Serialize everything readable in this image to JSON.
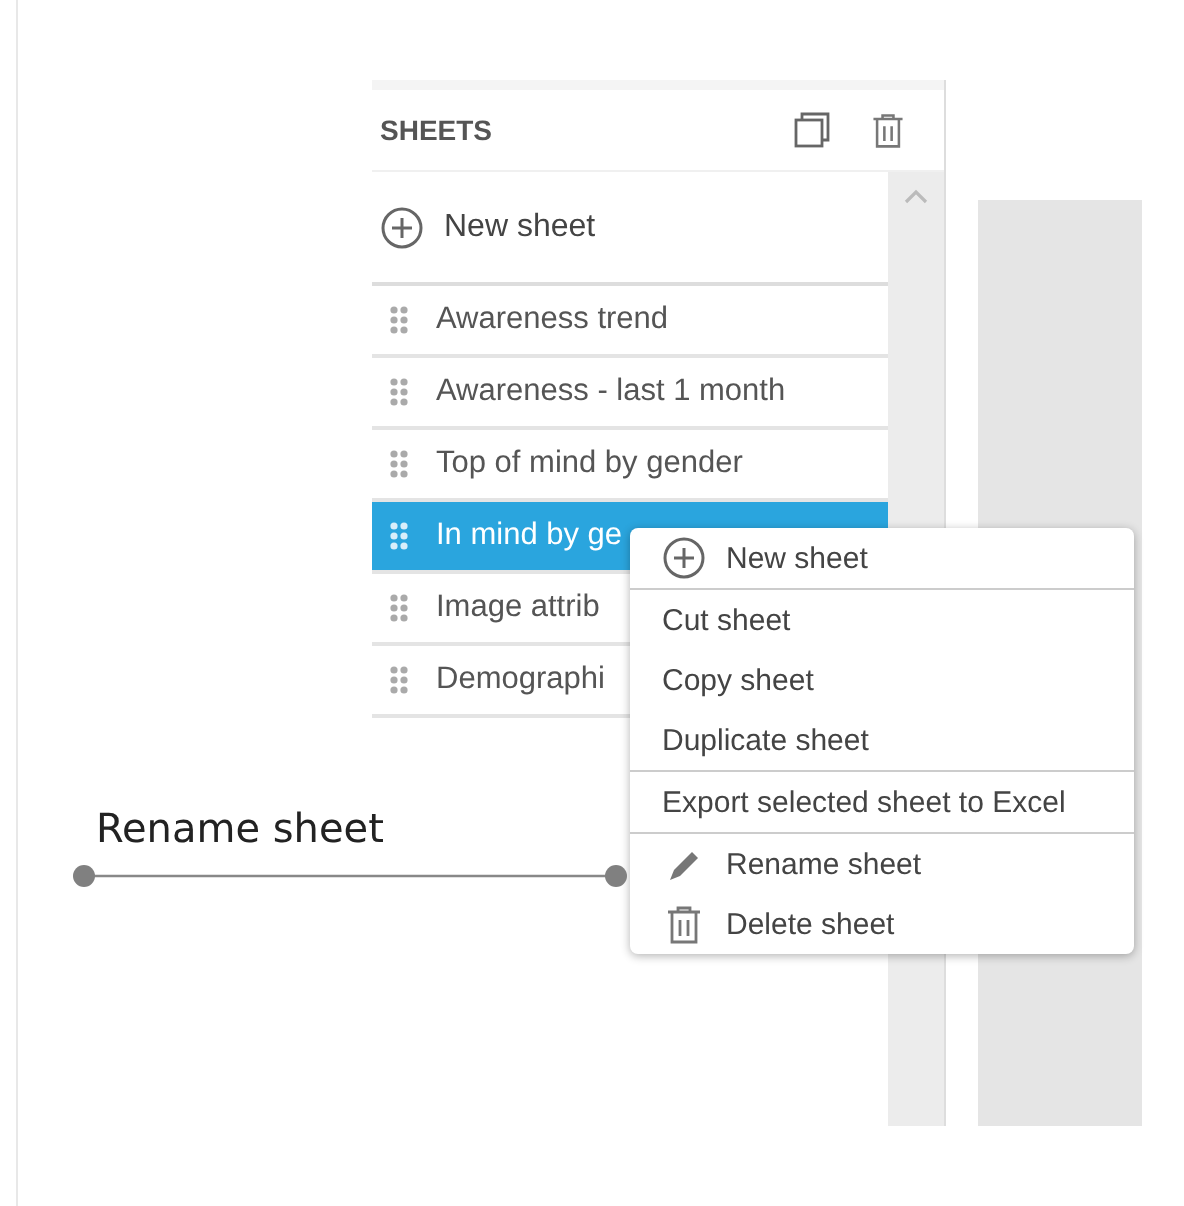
{
  "panel": {
    "title": "SHEETS",
    "new_sheet": "New sheet",
    "sheets": [
      {
        "label": "Awareness trend",
        "selected": false
      },
      {
        "label": "Awareness - last 1 month",
        "selected": false
      },
      {
        "label": "Top of mind by gender",
        "selected": false
      },
      {
        "label": "In mind by ge",
        "selected": true
      },
      {
        "label": "Image attrib",
        "selected": false
      },
      {
        "label": "Demographi",
        "selected": false
      }
    ]
  },
  "context_menu": [
    {
      "label": "New sheet",
      "kind": "add",
      "divider": true
    },
    {
      "label": "Cut sheet",
      "kind": "plain",
      "divider": false
    },
    {
      "label": "Copy sheet",
      "kind": "plain",
      "divider": false
    },
    {
      "label": "Duplicate sheet",
      "kind": "plain",
      "divider": true
    },
    {
      "label": "Export selected sheet to Excel",
      "kind": "plain",
      "divider": true
    },
    {
      "label": "Rename sheet",
      "kind": "edit",
      "divider": false
    },
    {
      "label": "Delete sheet",
      "kind": "delete",
      "divider": false
    }
  ],
  "annotation": {
    "label": "Rename sheet"
  }
}
